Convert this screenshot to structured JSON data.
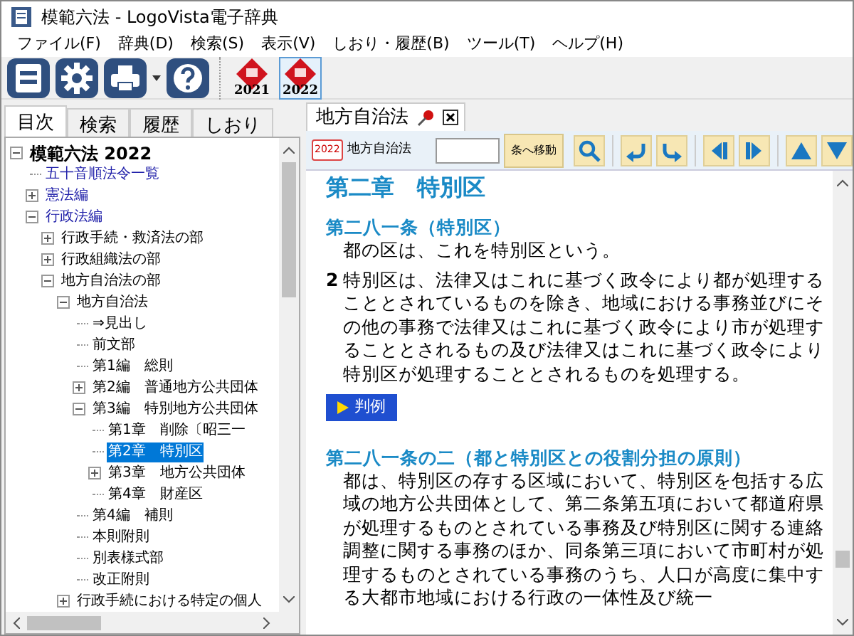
{
  "window": {
    "title": "模範六法 - LogoVista電子辞典"
  },
  "menu": [
    "ファイル(F)",
    "辞典(D)",
    "検索(S)",
    "表示(V)",
    "しおり・履歴(B)",
    "ツール(T)",
    "ヘルプ(H)"
  ],
  "toolbar": {
    "dictionaries": [
      {
        "year": "2021",
        "selected": false
      },
      {
        "year": "2022",
        "selected": true
      }
    ]
  },
  "sidebar": {
    "tabs": [
      {
        "label": "目次",
        "selected": true
      },
      {
        "label": "検索",
        "selected": false
      },
      {
        "label": "履歴",
        "selected": false
      },
      {
        "label": "しおり",
        "selected": false
      }
    ],
    "tree": [
      {
        "label": "模範六法 2022",
        "expanded": true,
        "selected": false,
        "children": [
          {
            "label": "五十音順法令一覧",
            "selected": false
          },
          {
            "label": "憲法編",
            "expanded": false,
            "selected": false
          },
          {
            "label": "行政法編",
            "expanded": true,
            "selected": false,
            "children": [
              {
                "label": "行政手続・救済法の部",
                "expanded": false,
                "selected": false
              },
              {
                "label": "行政組織法の部",
                "expanded": false,
                "selected": false
              },
              {
                "label": "地方自治法の部",
                "expanded": true,
                "selected": false,
                "children": [
                  {
                    "label": "地方自治法",
                    "expanded": true,
                    "selected": false,
                    "children": [
                      {
                        "label": "⇒見出し",
                        "selected": false
                      },
                      {
                        "label": "前文部",
                        "selected": false
                      },
                      {
                        "label": "第1編　総則",
                        "selected": false
                      },
                      {
                        "label": "第2編　普通地方公共団体",
                        "expanded": false,
                        "selected": false
                      },
                      {
                        "label": "第3編　特別地方公共団体",
                        "expanded": true,
                        "selected": false,
                        "children": [
                          {
                            "label": "第1章　削除〔昭三一",
                            "selected": false
                          },
                          {
                            "label": "第2章　特別区",
                            "selected": true
                          },
                          {
                            "label": "第3章　地方公共団体",
                            "expanded": false,
                            "selected": false
                          },
                          {
                            "label": "第4章　財産区",
                            "selected": false
                          }
                        ]
                      },
                      {
                        "label": "第4編　補則",
                        "selected": false
                      },
                      {
                        "label": "本則附則",
                        "selected": false
                      },
                      {
                        "label": "別表様式部",
                        "selected": false
                      },
                      {
                        "label": "改正附則",
                        "selected": false
                      }
                    ]
                  },
                  {
                    "label": "行政手続における特定の個人",
                    "expanded": false,
                    "selected": false
                  }
                ]
              }
            ]
          }
        ]
      }
    ]
  },
  "document": {
    "tab": {
      "label": "地方自治法"
    },
    "dict_badge": "2022",
    "book_title": "地方自治法",
    "goto_button": "条へ移動",
    "chapter_heading": "第二章　特別区",
    "articles": [
      {
        "heading": "第二八一条（特別区）",
        "paragraphs": [
          {
            "text": "都の区は、これを特別区という。"
          },
          {
            "number": "2",
            "text": "特別区は、法律又はこれに基づく政令により都が処理することとされているものを除き、地域における事務並びにその他の事務で法律又はこれに基づく政令により市が処理することとされるもの及び法律又はこれに基づく政令により特別区が処理することとされるものを処理する。"
          }
        ],
        "precedent_button": "判例"
      },
      {
        "heading": "第二八一条の二（都と特別区との役割分担の原則）",
        "paragraphs": [
          {
            "text": "都は、特別区の存する区域において、特別区を包括する広域の地方公共団体として、第二条第五項において都道府県が処理するものとされている事務及び特別区に関する連絡調整に関する事務のほか、同条第三項において市町村が処理するものとされている事務のうち、人口が高度に集中する大都市地域における行政の一体性及び統一"
          }
        ]
      }
    ]
  }
}
